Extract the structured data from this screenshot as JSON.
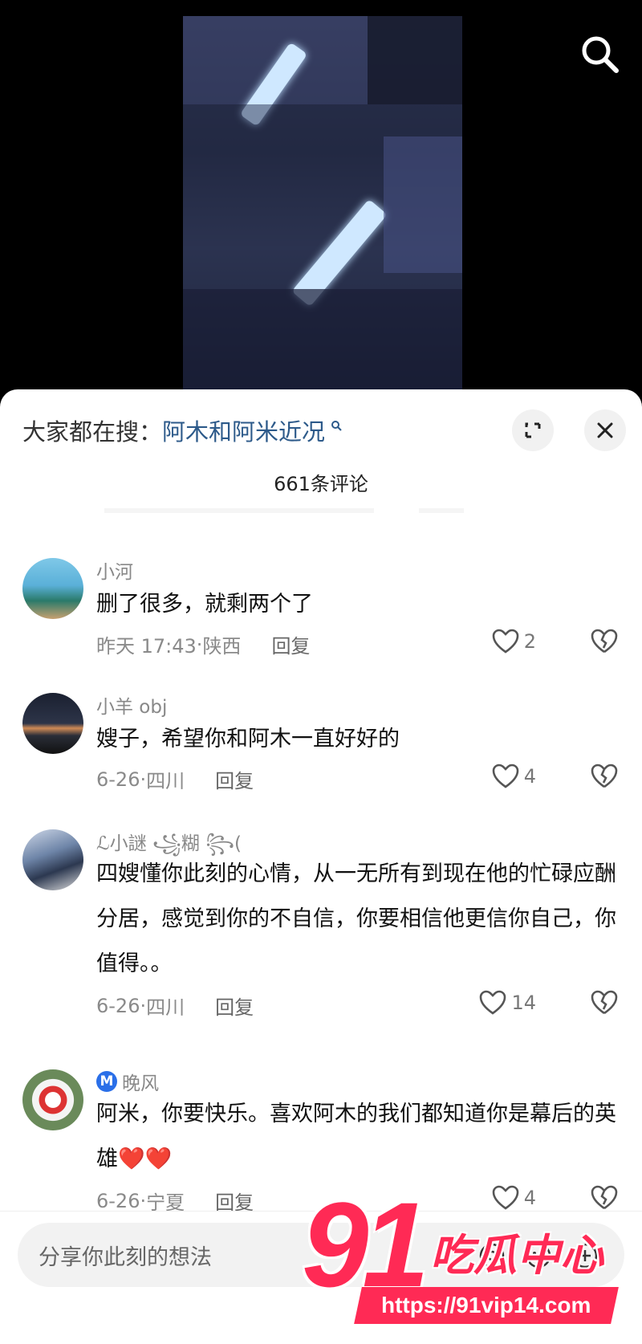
{
  "search_bar": {
    "prefix": "大家都在搜：",
    "keyword": "阿木和阿米近况"
  },
  "comment_count": "661条评论",
  "comments": [
    {
      "user": "小河",
      "verified": false,
      "text": "删了很多，就剩两个了",
      "date": "昨天 17:43",
      "location": "陕西",
      "likes": "2"
    },
    {
      "user": "小羊 obj",
      "verified": false,
      "text": "嫂子，希望你和阿木一直好好的",
      "date": "6-26",
      "location": "四川",
      "likes": "4"
    },
    {
      "user": "ℒ小謎 ꧁糊 ꧂(",
      "verified": false,
      "text": "四嫂懂你此刻的心情，从一无所有到现在他的忙碌应酬分居，感觉到你的不自信，你要相信他更信你自己，你值得。。",
      "date": "6-26",
      "location": "四川",
      "likes": "14"
    },
    {
      "user": "晚风",
      "verified": true,
      "text": "阿米，你要快乐。喜欢阿木的我们都知道你是幕后的英雄❤️❤️",
      "date": "6-26",
      "location": "宁夏",
      "likes": "4"
    }
  ],
  "reply_label": "回复",
  "meta_separator": "·",
  "input_placeholder": "分享你此刻的想法",
  "watermark": {
    "number": "91",
    "text": "吃瓜中心",
    "url": "https://91vip14.com"
  },
  "colors": {
    "accent": "#2d5a8a",
    "watermark": "#ff2a55"
  }
}
